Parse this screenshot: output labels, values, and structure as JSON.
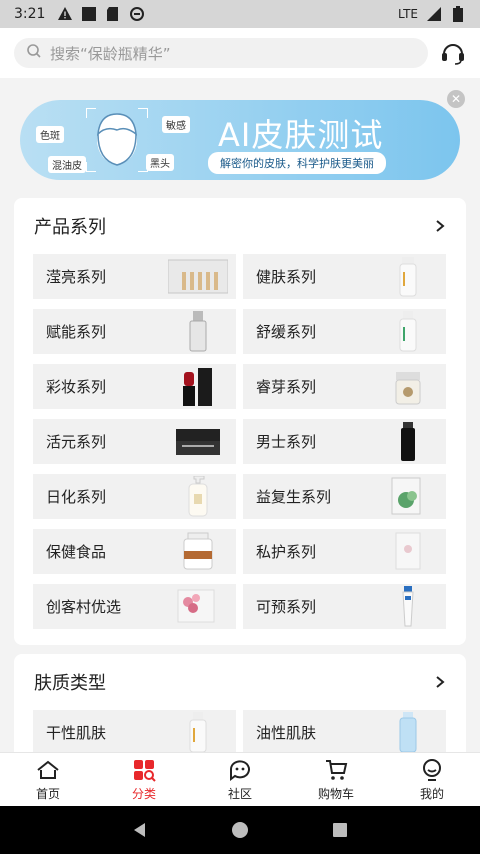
{
  "status_bar": {
    "time": "3:21",
    "network": "LTE"
  },
  "search": {
    "placeholder": "搜索“保龄瓶精华”"
  },
  "banner": {
    "title": "AI皮肤测试",
    "subtitle": "解密你的皮肤，科学护肤更美丽",
    "tags": [
      "色斑",
      "敏感",
      "混油皮",
      "黑头"
    ]
  },
  "product_series": {
    "title": "产品系列",
    "items": [
      {
        "label": "滢亮系列"
      },
      {
        "label": "健肤系列"
      },
      {
        "label": "赋能系列"
      },
      {
        "label": "舒缓系列"
      },
      {
        "label": "彩妆系列"
      },
      {
        "label": "睿芽系列"
      },
      {
        "label": "活元系列"
      },
      {
        "label": "男士系列"
      },
      {
        "label": "日化系列"
      },
      {
        "label": "益复生系列"
      },
      {
        "label": "保健食品"
      },
      {
        "label": "私护系列"
      },
      {
        "label": "创客村优选"
      },
      {
        "label": "可预系列"
      }
    ]
  },
  "skin_types": {
    "title": "肤质类型",
    "items": [
      {
        "label": "干性肌肤"
      },
      {
        "label": "油性肌肤"
      }
    ]
  },
  "tabbar": {
    "tabs": [
      {
        "label": "首页",
        "icon": "home-icon"
      },
      {
        "label": "分类",
        "icon": "category-icon",
        "active": true
      },
      {
        "label": "社区",
        "icon": "community-icon"
      },
      {
        "label": "购物车",
        "icon": "cart-icon"
      },
      {
        "label": "我的",
        "icon": "profile-icon"
      }
    ]
  },
  "colors": {
    "accent": "#e8282b",
    "banner_blue": "#7cc5ee"
  }
}
